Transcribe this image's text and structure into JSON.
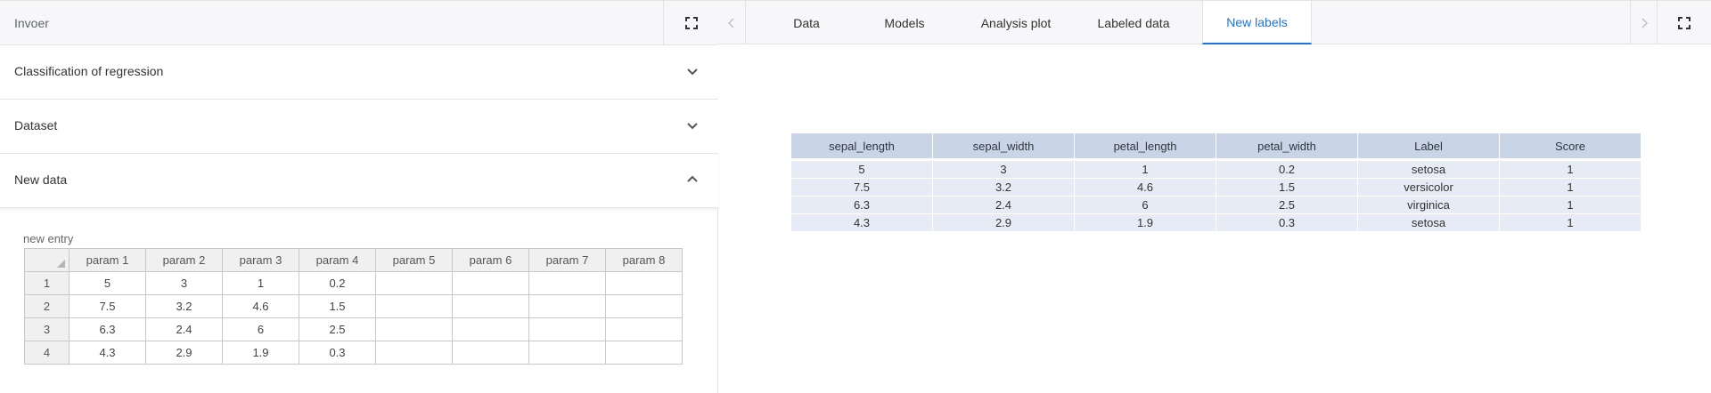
{
  "left": {
    "title": "Invoer",
    "sections": [
      {
        "label": "Classification of regression",
        "state": "collapsed"
      },
      {
        "label": "Dataset",
        "state": "collapsed"
      },
      {
        "label": "New data",
        "state": "expanded"
      }
    ],
    "new_data": {
      "entry_label": "new entry",
      "columns": [
        "param 1",
        "param 2",
        "param 3",
        "param 4",
        "param 5",
        "param 6",
        "param 7",
        "param 8"
      ],
      "rows": [
        {
          "id": "1",
          "values": [
            "5",
            "3",
            "1",
            "0.2",
            "",
            "",
            "",
            ""
          ]
        },
        {
          "id": "2",
          "values": [
            "7.5",
            "3.2",
            "4.6",
            "1.5",
            "",
            "",
            "",
            ""
          ]
        },
        {
          "id": "3",
          "values": [
            "6.3",
            "2.4",
            "6",
            "2.5",
            "",
            "",
            "",
            ""
          ]
        },
        {
          "id": "4",
          "values": [
            "4.3",
            "2.9",
            "1.9",
            "0.3",
            "",
            "",
            "",
            ""
          ]
        }
      ]
    }
  },
  "right": {
    "tabs": [
      "Data",
      "Models",
      "Analysis plot",
      "Labeled data",
      "New labels"
    ],
    "active_tab": "New labels",
    "result_table": {
      "columns": [
        "sepal_length",
        "sepal_width",
        "petal_length",
        "petal_width",
        "Label",
        "Score"
      ],
      "rows": [
        [
          "5",
          "3",
          "1",
          "0.2",
          "setosa",
          "1"
        ],
        [
          "7.5",
          "3.2",
          "4.6",
          "1.5",
          "versicolor",
          "1"
        ],
        [
          "6.3",
          "2.4",
          "6",
          "2.5",
          "virginica",
          "1"
        ],
        [
          "4.3",
          "2.9",
          "1.9",
          "0.3",
          "setosa",
          "1"
        ]
      ]
    }
  },
  "colors": {
    "accent": "#1a73e8",
    "header_bg": "#f7f7f9",
    "result_header_bg": "#c9d5e6",
    "result_cell_bg": "#e6ebf5"
  },
  "icons": {
    "expand": "fullscreen-icon",
    "collapse": "chevron-down-icon",
    "expanded": "chevron-up-icon",
    "tab_left": "chevron-left-icon",
    "tab_right": "chevron-right-icon"
  }
}
